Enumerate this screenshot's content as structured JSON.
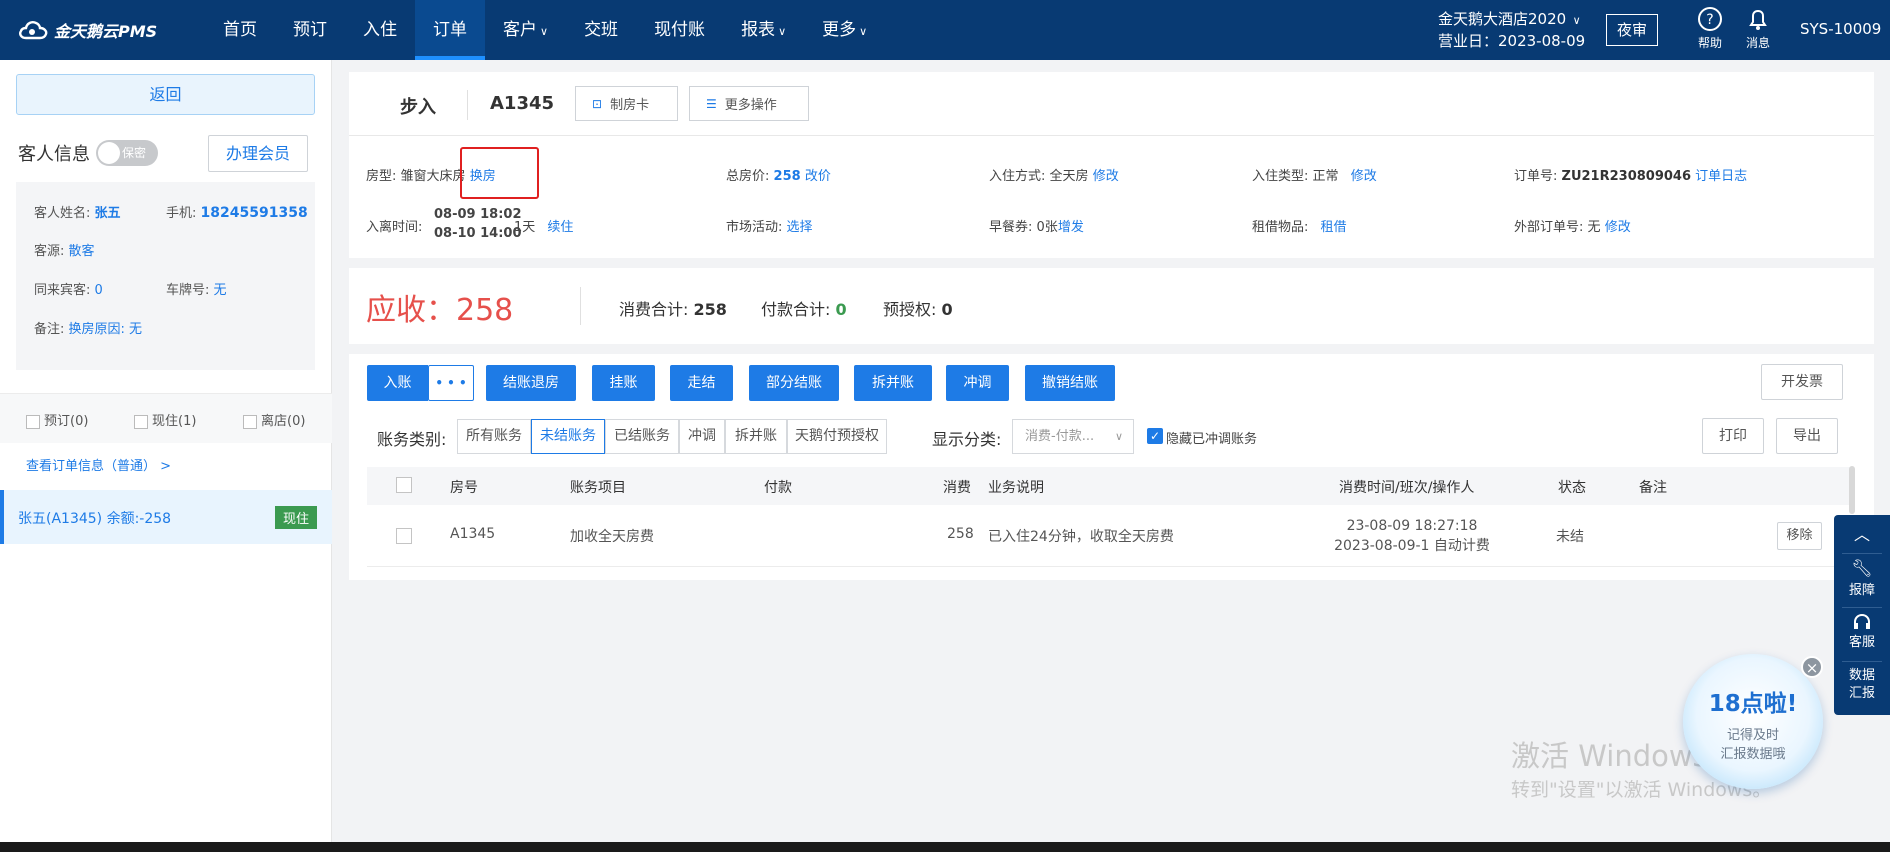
{
  "topbar": {
    "logo": "金天鹅云PMS",
    "nav": [
      {
        "label": "首页",
        "chevron": false
      },
      {
        "label": "预订",
        "chevron": false
      },
      {
        "label": "入住",
        "chevron": false
      },
      {
        "label": "订单",
        "chevron": false,
        "active": true
      },
      {
        "label": "客户",
        "chevron": true
      },
      {
        "label": "交班",
        "chevron": false
      },
      {
        "label": "现付账",
        "chevron": false
      },
      {
        "label": "报表",
        "chevron": true
      },
      {
        "label": "更多",
        "chevron": true
      }
    ],
    "hotel_name": "金天鹅大酒店2020",
    "business_day": "营业日：2023-08-09",
    "night_audit": "夜审",
    "help": "帮助",
    "messages": "消息",
    "user": "SYS-10009"
  },
  "left": {
    "back": "返回",
    "guest_info_title": "客人信息",
    "privacy_label": "保密",
    "member_button": "办理会员",
    "guest_name_label": "客人姓名:",
    "guest_name": "张五",
    "phone_label": "手机:",
    "phone": "18245591358",
    "source_label": "客源:",
    "source": "散客",
    "companions_label": "同来宾客:",
    "companions": "0",
    "plate_label": "车牌号:",
    "plate": "无",
    "note_label": "备注:",
    "note": "换房原因: 无",
    "statuses": [
      "预订(0)",
      "现住(1)",
      "离店(0)"
    ],
    "view_order": "查看订单信息（普通） >",
    "guest_row": "张五(A1345)  余额:-258",
    "guest_row_badge": "现住"
  },
  "header": {
    "type": "步入",
    "room": "A1345",
    "make_card": "制房卡",
    "more_ops": "更多操作"
  },
  "info": {
    "room_type_label": "房型:",
    "room_type": "雏窗大床房",
    "change_room": "换房",
    "total_label": "总房价:",
    "total_value": "258",
    "change_price": "改价",
    "checkin_mode_label": "入住方式:",
    "checkin_mode": "全天房",
    "modify": "修改",
    "checkin_type_label": "入住类型:",
    "checkin_type": "正常",
    "order_no_label": "订单号:",
    "order_no": "ZU21R230809046",
    "order_log": "订单日志",
    "stay_label": "入离时间:",
    "arrive": "08-09 18:02",
    "depart": "08-10 14:00",
    "nights": "1天",
    "extend": "续住",
    "market_label": "市场活动:",
    "market_select": "选择",
    "breakfast_label": "早餐券:",
    "breakfast": "0张",
    "breakfast_add": "增发",
    "rental_label": "租借物品:",
    "rental": "租借",
    "ext_order_label": "外部订单号:",
    "ext_order": "无"
  },
  "summary": {
    "receivable": "应收：258",
    "consume_label": "消费合计:",
    "consume": "258",
    "payment_label": "付款合计:",
    "payment": "0",
    "preauth_label": "预授权:",
    "preauth": "0"
  },
  "actions": {
    "post": "入账",
    "more": "• • •",
    "checkout": "结账退房",
    "hang": "挂账",
    "walk": "走结",
    "partial": "部分结账",
    "split": "拆并账",
    "reverse": "冲调",
    "cancel_checkout": "撤销结账",
    "invoice": "开发票"
  },
  "filters": {
    "category_label": "账务类别:",
    "categories": [
      "所有账务",
      "未结账务",
      "已结账务",
      "冲调",
      "拆并账",
      "天鹅付预授权"
    ],
    "display_label": "显示分类:",
    "display_value": "消费-付款...",
    "hide_reversed": "隐藏已冲调账务",
    "print": "打印",
    "export": "导出"
  },
  "table": {
    "headers": [
      "房号",
      "账务项目",
      "付款",
      "消费",
      "业务说明",
      "消费时间/班次/操作人",
      "状态",
      "备注"
    ],
    "rows": [
      {
        "room": "A1345",
        "item": "加收全天房费",
        "payment": "",
        "consume": "258",
        "desc": "已入住24分钟，收取全天房费",
        "time1": "23-08-09 18:27:18",
        "time2": "2023-08-09-1 自动计费",
        "status": "未结",
        "remark": "",
        "action": "移除"
      }
    ]
  },
  "side": {
    "report": "报障",
    "service": "客服",
    "data_report_1": "数据",
    "data_report_2": "汇报"
  },
  "bubble": {
    "title": "18点啦!",
    "line1": "记得及时",
    "line2": "汇报数据哦"
  },
  "watermark": {
    "line1": "激活 Windows",
    "line2": "转到\"设置\"以激活 Windows。"
  }
}
